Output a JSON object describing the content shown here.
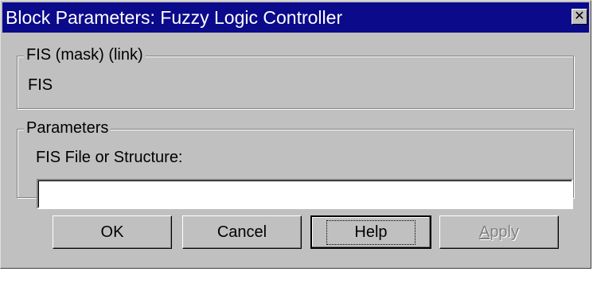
{
  "window": {
    "title": "Block Parameters: Fuzzy Logic  Controller",
    "close_glyph": "✕"
  },
  "mask_group": {
    "legend": "FIS (mask) (link)",
    "description": "FIS"
  },
  "params_group": {
    "legend": "Parameters",
    "field_label": "FIS File or Structure:",
    "field_value": ""
  },
  "buttons": {
    "ok": "OK",
    "cancel": "Cancel",
    "help": "Help",
    "apply": "Apply"
  },
  "icons": {
    "close": "close-icon"
  }
}
